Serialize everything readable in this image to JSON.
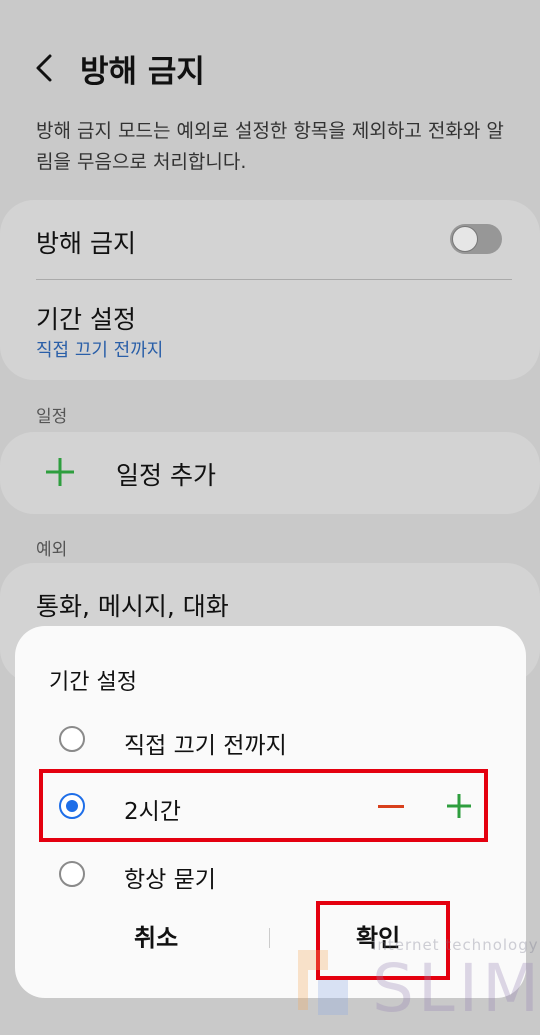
{
  "header": {
    "title": "방해 금지",
    "description": "방해 금지 모드는 예외로 설정한 항목을 제외하고 전화와 알림을 무음으로 처리합니다."
  },
  "settings": {
    "dnd_label": "방해 금지",
    "dnd_enabled": false,
    "duration_label": "기간 설정",
    "duration_value": "직접 끄기 전까지"
  },
  "schedule": {
    "section_label": "일정",
    "add_label": "일정 추가"
  },
  "exceptions": {
    "section_label": "예외",
    "item_label": "통화, 메시지, 대화"
  },
  "dialog": {
    "title": "기간 설정",
    "options": [
      {
        "label": "직접 끄기 전까지",
        "selected": false
      },
      {
        "label": "2시간",
        "selected": true
      },
      {
        "label": "항상 묻기",
        "selected": false
      }
    ],
    "cancel_label": "취소",
    "ok_label": "확인"
  },
  "watermark": {
    "small": "Internet technology",
    "brand": "SLIM"
  },
  "colors": {
    "accent_blue": "#1e6ee8",
    "link_blue": "#2a5fa8",
    "add_green": "#2e9e3e",
    "minus_orange": "#d8401c",
    "highlight_red": "#e4000f"
  }
}
